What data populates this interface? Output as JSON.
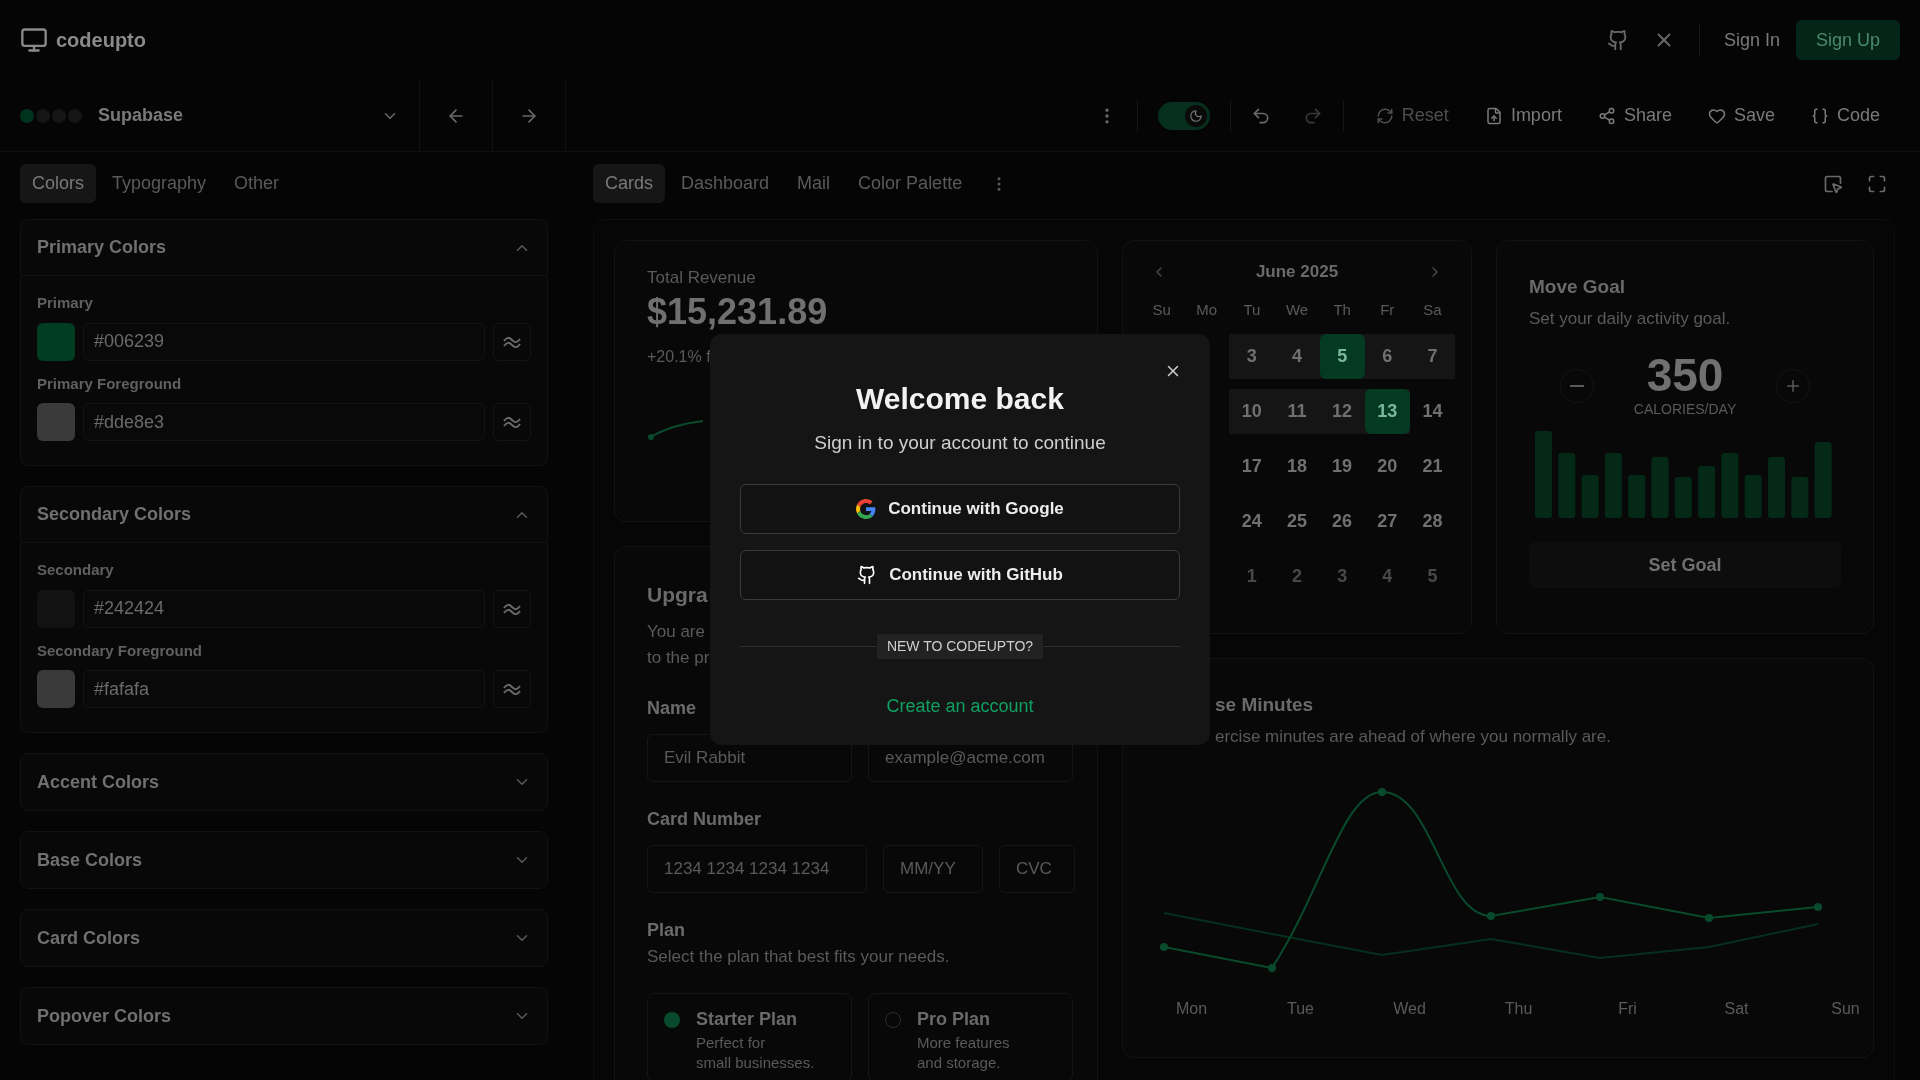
{
  "header": {
    "logo": "codeupto",
    "sign_in": "Sign In",
    "sign_up": "Sign Up"
  },
  "toolbar": {
    "swatches": [
      {
        "color": "#00331d"
      },
      {
        "color": "#161616"
      },
      {
        "color": "#161616"
      },
      {
        "color": "#161616"
      }
    ],
    "theme_name": "Supabase",
    "dark_mode": true,
    "actions": [
      {
        "label": "Reset",
        "disabled": true
      },
      {
        "label": "Import",
        "disabled": false
      },
      {
        "label": "Share",
        "disabled": false
      },
      {
        "label": "Save",
        "disabled": false
      },
      {
        "label": "Code",
        "disabled": false
      }
    ]
  },
  "sidebar": {
    "tabs": [
      {
        "label": "Colors",
        "selected": true
      },
      {
        "label": "Typography",
        "selected": false
      },
      {
        "label": "Other",
        "selected": false
      }
    ],
    "sections": [
      {
        "title": "Primary Colors",
        "expanded": true,
        "fields": [
          {
            "label": "Primary",
            "value": "#006239",
            "color": "#003d23"
          },
          {
            "label": "Primary Foreground",
            "value": "#dde8e3",
            "color": "#3a3a3a"
          }
        ]
      },
      {
        "title": "Secondary Colors",
        "expanded": true,
        "fields": [
          {
            "label": "Secondary",
            "value": "#242424",
            "color": "#121212"
          },
          {
            "label": "Secondary Foreground",
            "value": "#fafafa",
            "color": "#3a3a3a"
          }
        ]
      },
      {
        "title": "Accent Colors",
        "expanded": false
      },
      {
        "title": "Base Colors",
        "expanded": false
      },
      {
        "title": "Card Colors",
        "expanded": false
      },
      {
        "title": "Popover Colors",
        "expanded": false
      }
    ]
  },
  "preview_tabs": [
    {
      "label": "Cards",
      "selected": true
    },
    {
      "label": "Dashboard",
      "selected": false
    },
    {
      "label": "Mail",
      "selected": false
    },
    {
      "label": "Color Palette",
      "selected": false
    }
  ],
  "revenue": {
    "label": "Total Revenue",
    "value": "$15,231.89",
    "change": "+20.1% f"
  },
  "upgrade": {
    "title": "Upgra",
    "desc": [
      "You are",
      "to the pr"
    ],
    "name_label": "Name",
    "name_placeholder": "Evil Rabbit",
    "email_placeholder": "example@acme.com",
    "card_label": "Card Number",
    "card_placeholders": [
      "1234 1234 1234 1234",
      "MM/YY",
      "CVC"
    ],
    "plan_label": "Plan",
    "plan_desc": "Select the plan that best fits your needs.",
    "plans": [
      {
        "name": "Starter Plan",
        "desc": [
          "Perfect for",
          "small businesses."
        ],
        "selected": true
      },
      {
        "name": "Pro Plan",
        "desc": [
          "More features",
          "and storage."
        ],
        "selected": false
      }
    ]
  },
  "calendar": {
    "month": "June 2025",
    "weekdays": [
      "Su",
      "Mo",
      "Tu",
      "We",
      "Th",
      "Fr",
      "Sa"
    ],
    "weeks": [
      [
        {
          "day": "3",
          "selected": false,
          "in_range": true,
          "outside": false
        },
        {
          "day": "4",
          "selected": false,
          "in_range": true,
          "outside": false
        },
        {
          "day": "5",
          "selected": true,
          "in_range": true,
          "outside": false
        },
        {
          "day": "6",
          "selected": false,
          "in_range": true,
          "outside": false
        },
        {
          "day": "7",
          "selected": false,
          "in_range": true,
          "outside": false
        }
      ],
      [
        {
          "day": "10",
          "selected": false,
          "in_range": true,
          "outside": false
        },
        {
          "day": "11",
          "selected": false,
          "in_range": true,
          "outside": false
        },
        {
          "day": "12",
          "selected": false,
          "in_range": true,
          "outside": false
        },
        {
          "day": "13",
          "selected": true,
          "in_range": true,
          "outside": false
        },
        {
          "day": "14",
          "selected": false,
          "in_range": false,
          "outside": false
        }
      ],
      [
        {
          "day": "17",
          "selected": false,
          "in_range": false,
          "outside": false
        },
        {
          "day": "18",
          "selected": false,
          "in_range": false,
          "outside": false
        },
        {
          "day": "19",
          "selected": false,
          "in_range": false,
          "outside": false
        },
        {
          "day": "20",
          "selected": false,
          "in_range": false,
          "outside": false
        },
        {
          "day": "21",
          "selected": false,
          "in_range": false,
          "outside": false
        }
      ],
      [
        {
          "day": "24",
          "selected": false,
          "in_range": false,
          "outside": false
        },
        {
          "day": "25",
          "selected": false,
          "in_range": false,
          "outside": false
        },
        {
          "day": "26",
          "selected": false,
          "in_range": false,
          "outside": false
        },
        {
          "day": "27",
          "selected": false,
          "in_range": false,
          "outside": false
        },
        {
          "day": "28",
          "selected": false,
          "in_range": false,
          "outside": false
        }
      ],
      [
        {
          "day": "1",
          "selected": false,
          "in_range": false,
          "outside": true
        },
        {
          "day": "2",
          "selected": false,
          "in_range": false,
          "outside": true
        },
        {
          "day": "3",
          "selected": false,
          "in_range": false,
          "outside": true
        },
        {
          "day": "4",
          "selected": false,
          "in_range": false,
          "outside": true
        },
        {
          "day": "5",
          "selected": false,
          "in_range": false,
          "outside": true
        }
      ]
    ]
  },
  "move_goal": {
    "title": "Move Goal",
    "desc": "Set your daily activity goal.",
    "value": "350",
    "unit": "CALORIES/DAY",
    "button": "Set Goal"
  },
  "exercise": {
    "title": "se Minutes",
    "desc": "ercise minutes are ahead of where you normally are.",
    "x_labels": [
      "Mon",
      "Tue",
      "Wed",
      "Thu",
      "Fri",
      "Sat",
      "Sun"
    ]
  },
  "dialog": {
    "title": "Welcome back",
    "subtitle": "Sign in to your account to continue",
    "providers": [
      {
        "kind": "google",
        "label": "Continue with Google"
      },
      {
        "kind": "github",
        "label": "Continue with GitHub"
      }
    ],
    "divider": "NEW TO CODEUPTO?",
    "link": "Create an account"
  }
}
